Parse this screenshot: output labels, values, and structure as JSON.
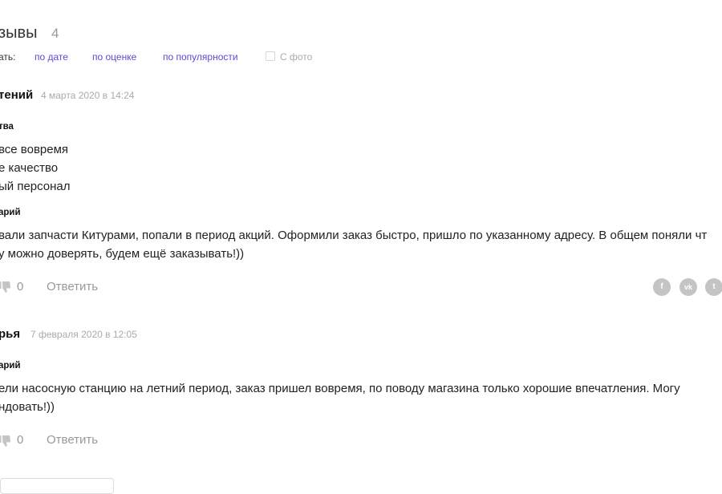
{
  "header": {
    "title": "зывы",
    "count": "4"
  },
  "sort": {
    "label": "ать:",
    "options": [
      "по дате",
      "по оценке",
      "по популярности"
    ],
    "photo_label": "С фото"
  },
  "reviews": [
    {
      "author": "тений",
      "date": "4 марта 2020 в 14:24",
      "pros_title": "тва",
      "pros": [
        "все вовремя",
        "е качество",
        "ый персонал"
      ],
      "comment_title": "арий",
      "comment": [
        "вали запчасти Китурами, попали в период акций. Оформили заказ быстро, пришло по указанному адресу. В общем поняли чт",
        "у можно доверять, будем ещё заказывать!))"
      ],
      "votes": "0",
      "reply": "Ответить"
    },
    {
      "author": "рья",
      "date": "7 февраля 2020 в 12:05",
      "comment_title": "арий",
      "comment": [
        "ели насосную станцию на летний период, заказ пришел вовремя, по поводу магазина только хорошие впечатления. Могу",
        "ндовать!))"
      ],
      "votes": "0",
      "reply": "Ответить"
    }
  ],
  "share": {
    "icons": [
      "facebook-icon",
      "vk-icon",
      "twitter-icon"
    ],
    "glyphs": [
      "f",
      "vk",
      "t"
    ],
    "color": "#c4c4c4"
  },
  "colors": {
    "accent": "#5b4bd6",
    "muted": "#999999"
  }
}
